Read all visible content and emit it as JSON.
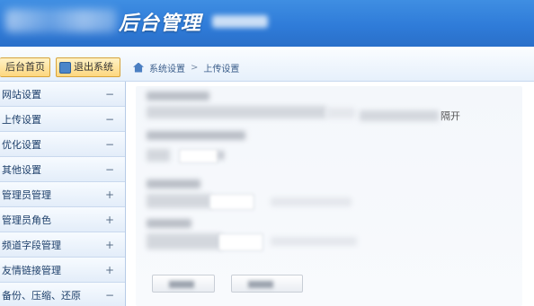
{
  "header": {
    "title": "后台管理"
  },
  "toolbar": {
    "home_label": "后台首页",
    "logout_label": "退出系统"
  },
  "breadcrumb": {
    "root": "系统设置",
    "separator": ">",
    "current": "上传设置"
  },
  "sidebar": {
    "items": [
      {
        "label": "网站设置",
        "toggle": "−"
      },
      {
        "label": "上传设置",
        "toggle": "−"
      },
      {
        "label": "优化设置",
        "toggle": "−"
      },
      {
        "label": "其他设置",
        "toggle": "−"
      },
      {
        "label": "管理员管理",
        "toggle": "+"
      },
      {
        "label": "管理员角色",
        "toggle": "+"
      },
      {
        "label": "频道字段管理",
        "toggle": "+"
      },
      {
        "label": "友情链接管理",
        "toggle": "+"
      },
      {
        "label": "备份、压缩、还原",
        "toggle": "−"
      }
    ]
  },
  "form": {
    "separator_hint": "隔开"
  },
  "colors": {
    "header_blue": "#2f7cd9",
    "button_gold": "#fdd77f",
    "sidebar_bg": "#eef4fc",
    "sidebar_text": "#1d3f6a"
  },
  "icons": {
    "home": "home-icon",
    "logout": "logout-icon",
    "breadcrumb_home": "home-icon"
  }
}
